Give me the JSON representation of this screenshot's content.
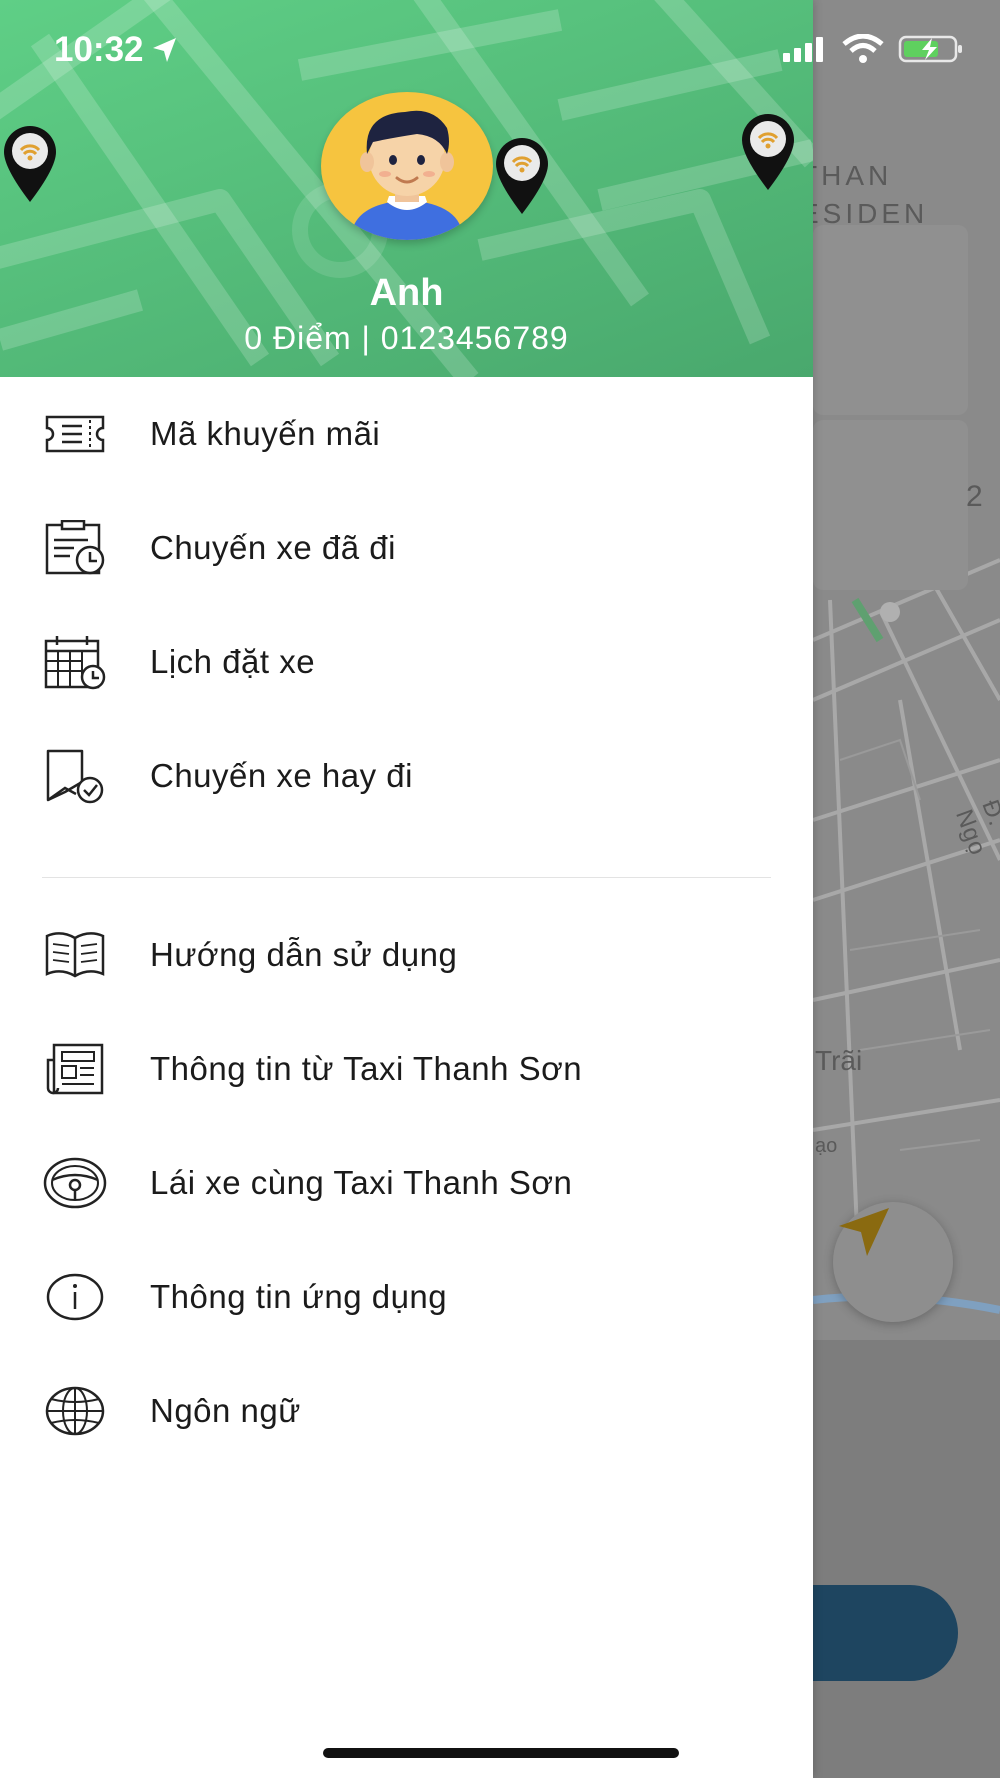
{
  "status_bar": {
    "time": "10:32",
    "icons": [
      "location-arrow-icon",
      "cellular-signal-icon",
      "wifi-icon",
      "battery-charging-icon"
    ]
  },
  "colors": {
    "header_gradient_start": "#5fcf86",
    "header_gradient_end": "#49a86d",
    "avatar_background": "#f6c43f",
    "primary_button": "#1e4560",
    "scrim": "#7a7a7a"
  },
  "profile": {
    "name": "Anh",
    "info": "0 Điểm | 0123456789",
    "avatar_icon": "user-avatar-icon"
  },
  "menu_primary": [
    {
      "label": "Mã khuyến mãi",
      "icon": "ticket-icon"
    },
    {
      "label": "Chuyến xe đã đi",
      "icon": "trip-history-icon"
    },
    {
      "label": "Lịch đặt xe",
      "icon": "calendar-clock-icon"
    },
    {
      "label": "Chuyến xe hay đi",
      "icon": "bookmark-check-icon"
    }
  ],
  "menu_secondary": [
    {
      "label": "Hướng dẫn sử dụng",
      "icon": "open-book-icon"
    },
    {
      "label": "Thông tin từ Taxi Thanh Sơn",
      "icon": "newspaper-icon"
    },
    {
      "label": "Lái xe cùng Taxi Thanh Sơn",
      "icon": "steering-wheel-icon"
    },
    {
      "label": "Thông tin ứng dụng",
      "icon": "info-icon"
    },
    {
      "label": "Ngôn ngữ",
      "icon": "globe-icon"
    }
  ],
  "map": {
    "labels": [
      "THAN",
      "ESIDEN",
      "2",
      "Đ. Ngọ",
      "Trãi",
      "ạo"
    ]
  }
}
